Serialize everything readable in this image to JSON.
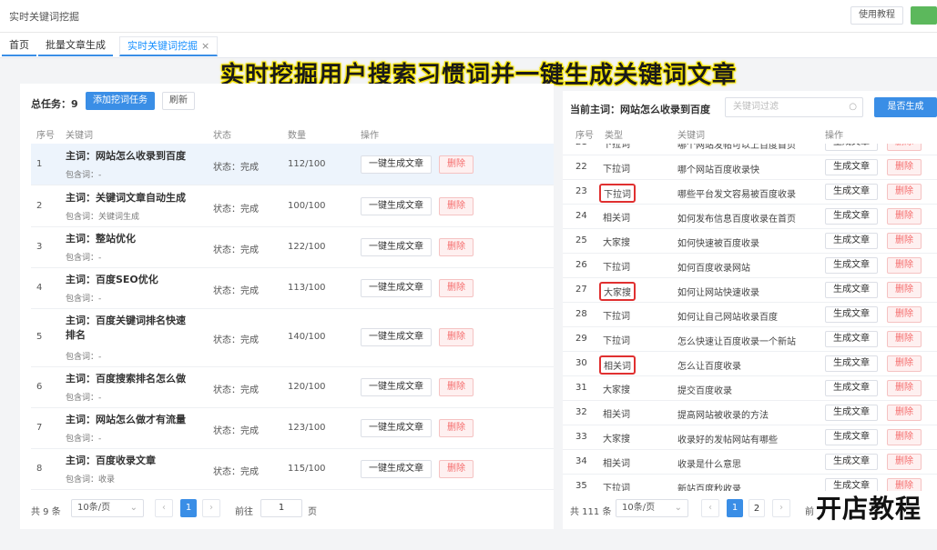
{
  "app": {
    "title": "实时关键词挖掘",
    "help_label": "使用教程"
  },
  "tabs": [
    {
      "label": "首页"
    },
    {
      "label": "批量文章生成"
    },
    {
      "label": "实时关键词挖掘",
      "close": "×"
    }
  ],
  "overlay_title": "实时挖掘用户搜索习惯词并一键生成关键词文章",
  "left": {
    "total_label": "总任务：9",
    "add_task_label": "添加挖词任务",
    "refresh_label": "刷新",
    "headers": {
      "idx": "序号",
      "keyword": "关键词",
      "status": "状态",
      "count": "数量",
      "action": "操作"
    },
    "rows": [
      {
        "idx": "1",
        "main": "主词：网站怎么收录到百度",
        "sub": "包含词：-",
        "status": "状态：完成",
        "count": "112/100"
      },
      {
        "idx": "2",
        "main": "主词：关键词文章自动生成",
        "sub": "包含词：关键词生成",
        "status": "状态：完成",
        "count": "100/100"
      },
      {
        "idx": "3",
        "main": "主词：整站优化",
        "sub": "包含词：-",
        "status": "状态：完成",
        "count": "122/100"
      },
      {
        "idx": "4",
        "main": "主词：百度SEO优化",
        "sub": "包含词：-",
        "status": "状态：完成",
        "count": "113/100"
      },
      {
        "idx": "5",
        "main": "主词：百度关键词排名快速排名",
        "sub": "包含词：-",
        "status": "状态：完成",
        "count": "140/100"
      },
      {
        "idx": "6",
        "main": "主词：百度搜索排名怎么做",
        "sub": "包含词：-",
        "status": "状态：完成",
        "count": "120/100"
      },
      {
        "idx": "7",
        "main": "主词：网站怎么做才有流量",
        "sub": "包含词：-",
        "status": "状态：完成",
        "count": "123/100"
      },
      {
        "idx": "8",
        "main": "主词：百度收录文章",
        "sub": "包含词：收录",
        "status": "状态：完成",
        "count": "115/100"
      }
    ],
    "gen_label": "一键生成文章",
    "del_label": "删除",
    "pager": {
      "total": "共 9 条",
      "page_size": "10条/页",
      "current": "1",
      "goto_label": "前往",
      "goto_value": "1",
      "page_unit": "页"
    }
  },
  "right": {
    "current_main": "当前主词：网站怎么收录到百度",
    "filter_placeholder": "关键词过滤",
    "gen_all_label": "是否生成",
    "headers": {
      "idx": "序号",
      "type": "类型",
      "keyword": "关键词",
      "action": "操作"
    },
    "rows": [
      {
        "idx": "21",
        "type": "下拉词",
        "keyword": "哪个网站发帖可以上百度首页",
        "boxed": false
      },
      {
        "idx": "22",
        "type": "下拉词",
        "keyword": "哪个网站百度收录快",
        "boxed": false
      },
      {
        "idx": "23",
        "type": "下拉词",
        "keyword": "哪些平台发文容易被百度收录",
        "boxed": true
      },
      {
        "idx": "24",
        "type": "相关词",
        "keyword": "如何发布信息百度收录在首页",
        "boxed": false
      },
      {
        "idx": "25",
        "type": "大家搜",
        "keyword": "如何快速被百度收录",
        "boxed": false
      },
      {
        "idx": "26",
        "type": "下拉词",
        "keyword": "如何百度收录网站",
        "boxed": false
      },
      {
        "idx": "27",
        "type": "大家搜",
        "keyword": "如何让网站快速收录",
        "boxed": true
      },
      {
        "idx": "28",
        "type": "下拉词",
        "keyword": "如何让自己网站收录百度",
        "boxed": false
      },
      {
        "idx": "29",
        "type": "下拉词",
        "keyword": "怎么快速让百度收录一个新站",
        "boxed": false
      },
      {
        "idx": "30",
        "type": "相关词",
        "keyword": "怎么让百度收录",
        "boxed": true
      },
      {
        "idx": "31",
        "type": "大家搜",
        "keyword": "提交百度收录",
        "boxed": false
      },
      {
        "idx": "32",
        "type": "相关词",
        "keyword": "提高网站被收录的方法",
        "boxed": false
      },
      {
        "idx": "33",
        "type": "大家搜",
        "keyword": "收录好的发帖网站有哪些",
        "boxed": false
      },
      {
        "idx": "34",
        "type": "相关词",
        "keyword": "收录是什么意思",
        "boxed": false
      },
      {
        "idx": "35",
        "type": "下拉词",
        "keyword": "新站百度秒收录",
        "boxed": false
      }
    ],
    "gen_label": "生成文章",
    "del_label": "删除",
    "pager": {
      "total": "共 111 条",
      "page_size": "10条/页",
      "pages": [
        "1",
        "2"
      ],
      "goto_label": "前"
    }
  },
  "brand": "开店教程",
  "icons": {
    "prev": "‹",
    "next": "›",
    "caret": "⌄",
    "search": "○"
  }
}
